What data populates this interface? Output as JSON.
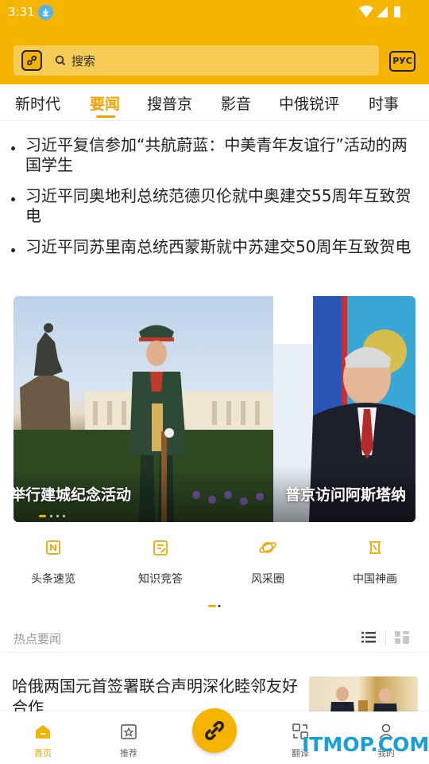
{
  "status_bar": {
    "time": "3:31"
  },
  "header": {
    "search_placeholder": "搜索",
    "language_button": "РУС"
  },
  "tabs": [
    {
      "label": "新时代",
      "active": false
    },
    {
      "label": "要闻",
      "active": true
    },
    {
      "label": "搜普京",
      "active": false
    },
    {
      "label": "影音",
      "active": false
    },
    {
      "label": "中俄锐评",
      "active": false
    },
    {
      "label": "时事",
      "active": false
    }
  ],
  "headlines": [
    {
      "text": "习近平复信参加“共航蔚蓝：中美青年友谊行”活动的两国学生"
    },
    {
      "text": "习近平同奥地利总统范德贝伦就中奥建交55周年互致贺电"
    },
    {
      "text": "习近平同苏里南总统西蒙斯就中苏建交50周年互致贺电"
    }
  ],
  "carousel": {
    "slides": [
      {
        "caption": "举行建城纪念活动"
      },
      {
        "caption": "普京访问阿斯塔纳"
      }
    ],
    "active_index": 0
  },
  "quick_menu": [
    {
      "label": "头条速览",
      "icon": "bookmark-icon"
    },
    {
      "label": "知识竞答",
      "icon": "quiz-icon"
    },
    {
      "label": "风采圈",
      "icon": "planet-icon"
    },
    {
      "label": "中国神画",
      "icon": "scroll-painting-icon"
    }
  ],
  "hot_news": {
    "section_title": "热点要闻",
    "items": [
      {
        "title": "哈俄两国元首签署联合声明深化睦邻友好合作"
      }
    ]
  },
  "bottom_nav": {
    "items": [
      {
        "label": "首页",
        "icon": "home-icon",
        "active": true
      },
      {
        "label": "推荐",
        "icon": "star-frame-icon",
        "active": false
      },
      {
        "label": "翻译",
        "icon": "translate-icon",
        "active": false
      },
      {
        "label": "我的",
        "icon": "user-icon",
        "active": false
      }
    ]
  },
  "watermark": "ITMOP.COM",
  "colors": {
    "accent": "#f5b400",
    "active_text": "#f5a300"
  }
}
